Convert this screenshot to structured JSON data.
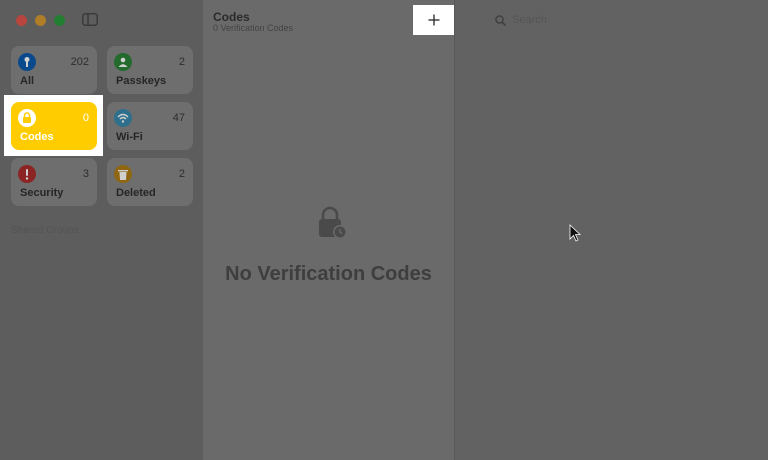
{
  "window": {
    "traffic_lights": {
      "close": "#ec5f55",
      "minimize": "#dda232",
      "zoom": "#29a83d"
    }
  },
  "sidebar": {
    "tiles": [
      {
        "label": "All",
        "count": "202",
        "icon": "key-icon",
        "color": "#0a60b8"
      },
      {
        "label": "Passkeys",
        "count": "2",
        "icon": "person-badge-icon",
        "color": "#2d8a38"
      },
      {
        "label": "Codes",
        "count": "0",
        "icon": "lock-clock-icon",
        "color": "#ffcc00",
        "selected": true
      },
      {
        "label": "Wi-Fi",
        "count": "47",
        "icon": "wifi-icon",
        "color": "#3a8fb5"
      },
      {
        "label": "Security",
        "count": "3",
        "icon": "exclamation-icon",
        "color": "#b52f2f"
      },
      {
        "label": "Deleted",
        "count": "2",
        "icon": "trash-icon",
        "color": "#c28a12"
      }
    ],
    "section_label": "Shared Groups"
  },
  "list": {
    "title": "Codes",
    "subtitle": "0 Verification Codes",
    "add_button": "+",
    "empty_message": "No Verification Codes"
  },
  "detail": {
    "search_placeholder": "Search"
  }
}
